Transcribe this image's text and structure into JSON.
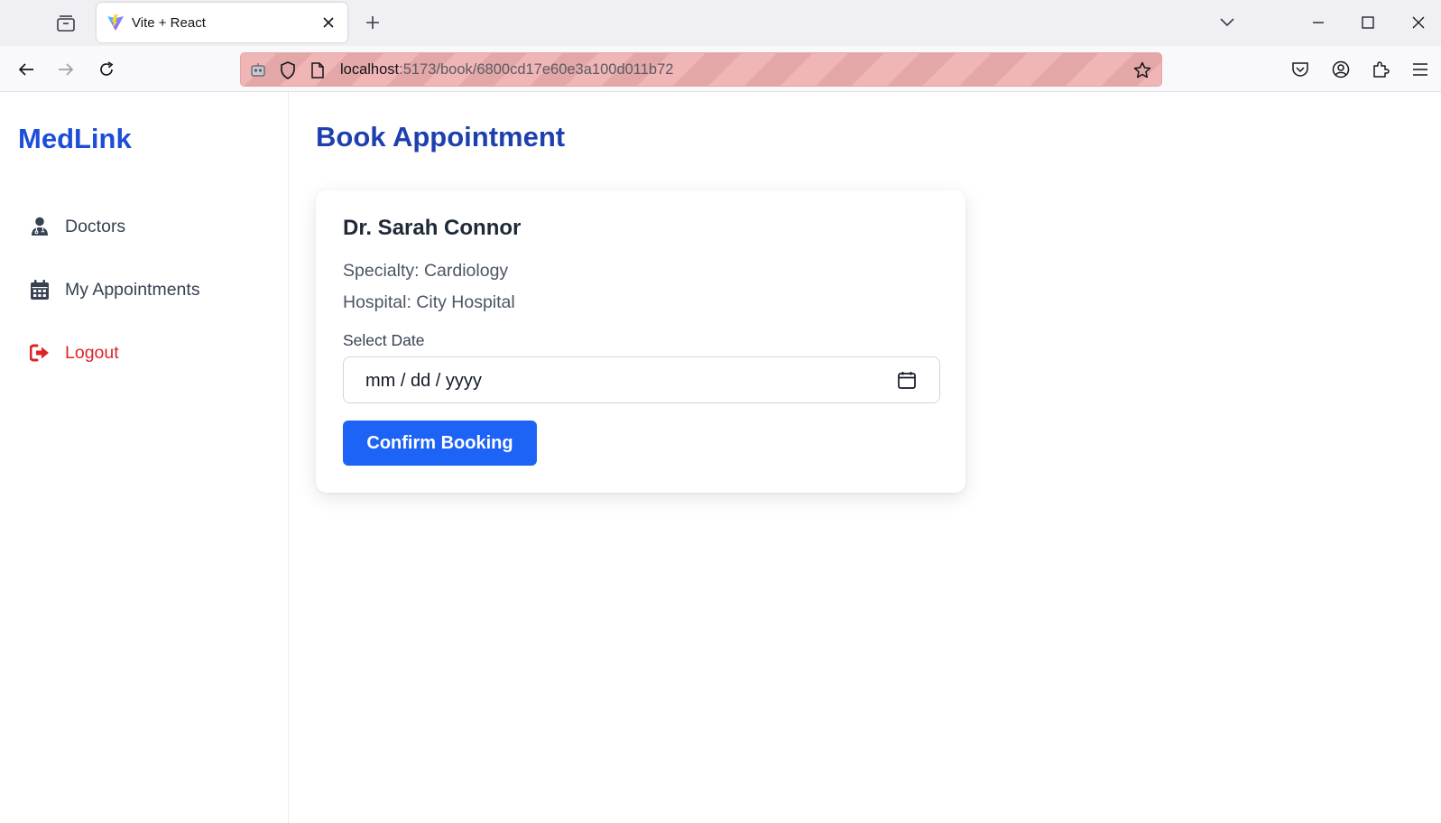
{
  "browser": {
    "tab_title": "Vite + React",
    "url_host": "localhost",
    "url_rest": ":5173/book/6800cd17e60e3a100d011b72"
  },
  "sidebar": {
    "brand": "MedLink",
    "items": [
      {
        "label": "Doctors",
        "icon": "doctor-icon"
      },
      {
        "label": "My Appointments",
        "icon": "calendar-icon"
      },
      {
        "label": "Logout",
        "icon": "logout-icon"
      }
    ]
  },
  "main": {
    "page_title": "Book Appointment",
    "doctor": {
      "name": "Dr. Sarah Connor",
      "specialty": "Specialty: Cardiology",
      "hospital": "Hospital: City Hospital"
    },
    "date_field": {
      "label": "Select Date",
      "placeholder": "mm / dd / yyyy"
    },
    "confirm_label": "Confirm Booking"
  },
  "colors": {
    "brand": "#1d4ed8",
    "title": "#1e40af",
    "button": "#1d63f5",
    "logout": "#dc2626"
  }
}
